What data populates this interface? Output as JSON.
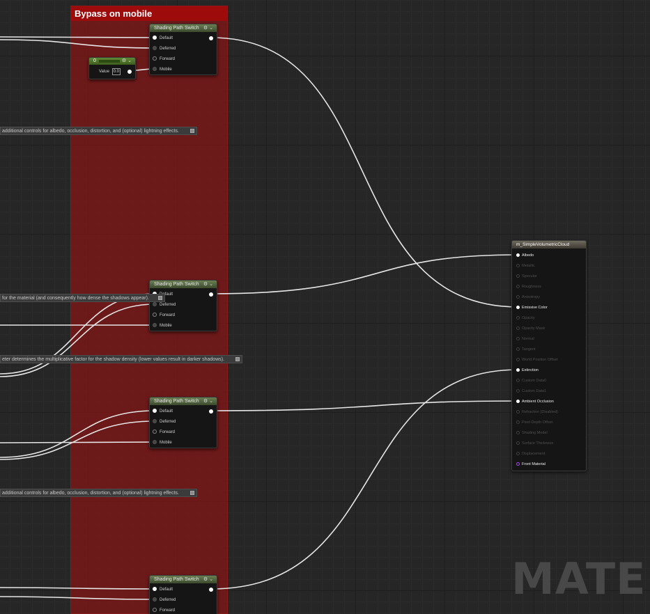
{
  "comment": {
    "title": "Bypass on mobile"
  },
  "switch_node": {
    "title": "Shading Path Switch",
    "controls": "⚙ ⌄",
    "pins": {
      "default": "Default",
      "deferred": "Deferred",
      "forward": "Forward",
      "mobile": "Mobile"
    }
  },
  "constant_node": {
    "title": "0",
    "controls": "⚙ ⌄",
    "value_label": "Value",
    "value": "0.0"
  },
  "notes": {
    "top": "additional controls for albedo, occlusion,  distortion, and (optional) lightning effects.",
    "density": "for the material (and consequently how dense the shadows appear).",
    "shadow": "eter determines the multiplicative factor for the shadow density (lower values result in darker shadows).",
    "bottom": "additional controls for albedo, occlusion,  distortion, and (optional) lightning effects."
  },
  "material_node": {
    "title": "m_SimpleVolumetricCloud",
    "inputs": [
      {
        "label": "Albedo",
        "active": true
      },
      {
        "label": "Metallic",
        "active": false
      },
      {
        "label": "Specular",
        "active": false
      },
      {
        "label": "Roughness",
        "active": false
      },
      {
        "label": "Anisotropy",
        "active": false
      },
      {
        "label": "Emissive Color",
        "active": true
      },
      {
        "label": "Opacity",
        "active": false
      },
      {
        "label": "Opacity Mask",
        "active": false
      },
      {
        "label": "Normal",
        "active": false
      },
      {
        "label": "Tangent",
        "active": false
      },
      {
        "label": "World Position Offset",
        "active": false
      },
      {
        "label": "Extinction",
        "active": true
      },
      {
        "label": "Custom Data0",
        "active": false
      },
      {
        "label": "Custom Data1",
        "active": false
      },
      {
        "label": "Ambient Occlusion",
        "active": true
      },
      {
        "label": "Refraction (Disabled)",
        "active": false
      },
      {
        "label": "Pixel Depth Offset",
        "active": false
      },
      {
        "label": "Shading Model",
        "active": false
      },
      {
        "label": "Surface Thickness",
        "active": false
      },
      {
        "label": "Displacement",
        "active": false
      },
      {
        "label": "Front Material",
        "active": true
      }
    ]
  },
  "watermark": "MATERIA",
  "colors": {
    "comment_bg": "#7f1616",
    "comment_title": "#9e0b0b",
    "wire": "#e6e6e6",
    "canvas": "#262626"
  }
}
